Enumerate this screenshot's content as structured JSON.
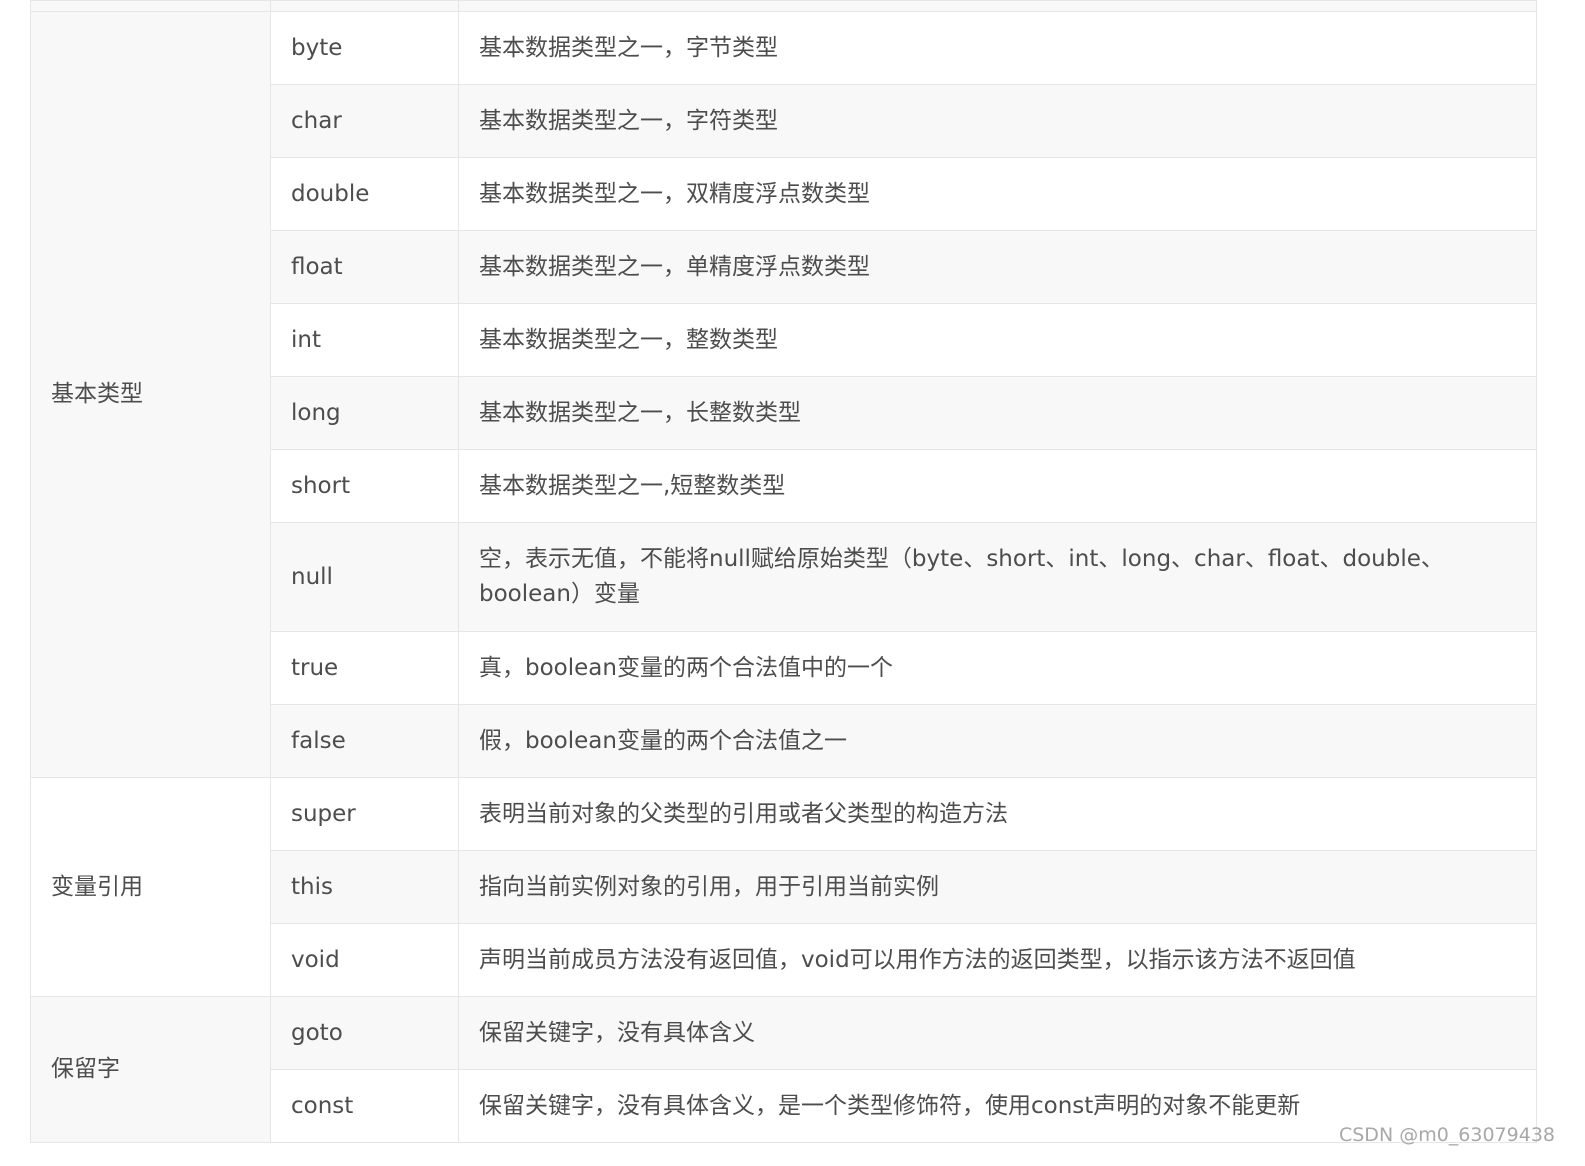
{
  "groups": [
    {
      "category": "基本类型",
      "rows": [
        {
          "keyword": "byte",
          "description": "基本数据类型之一，字节类型"
        },
        {
          "keyword": "char",
          "description": "基本数据类型之一，字符类型"
        },
        {
          "keyword": "double",
          "description": "基本数据类型之一，双精度浮点数类型"
        },
        {
          "keyword": "float",
          "description": "基本数据类型之一，单精度浮点数类型"
        },
        {
          "keyword": "int",
          "description": "基本数据类型之一，整数类型"
        },
        {
          "keyword": "long",
          "description": "基本数据类型之一，长整数类型"
        },
        {
          "keyword": "short",
          "description": "基本数据类型之一,短整数类型"
        },
        {
          "keyword": "null",
          "description": "空，表示无值，不能将null赋给原始类型（byte、short、int、long、char、float、double、boolean）变量"
        },
        {
          "keyword": "true",
          "description": "真，boolean变量的两个合法值中的一个"
        },
        {
          "keyword": "false",
          "description": "假，boolean变量的两个合法值之一"
        }
      ]
    },
    {
      "category": "变量引用",
      "rows": [
        {
          "keyword": "super",
          "description": "表明当前对象的父类型的引用或者父类型的构造方法"
        },
        {
          "keyword": "this",
          "description": "指向当前实例对象的引用，用于引用当前实例"
        },
        {
          "keyword": "void",
          "description": "声明当前成员方法没有返回值，void可以用作方法的返回类型，以指示该方法不返回值"
        }
      ]
    },
    {
      "category": "保留字",
      "rows": [
        {
          "keyword": "goto",
          "description": "保留关键字，没有具体含义"
        },
        {
          "keyword": "const",
          "description": "保留关键字，没有具体含义，是一个类型修饰符，使用const声明的对象不能更新"
        }
      ]
    }
  ],
  "watermark": "CSDN @m0_63079438"
}
